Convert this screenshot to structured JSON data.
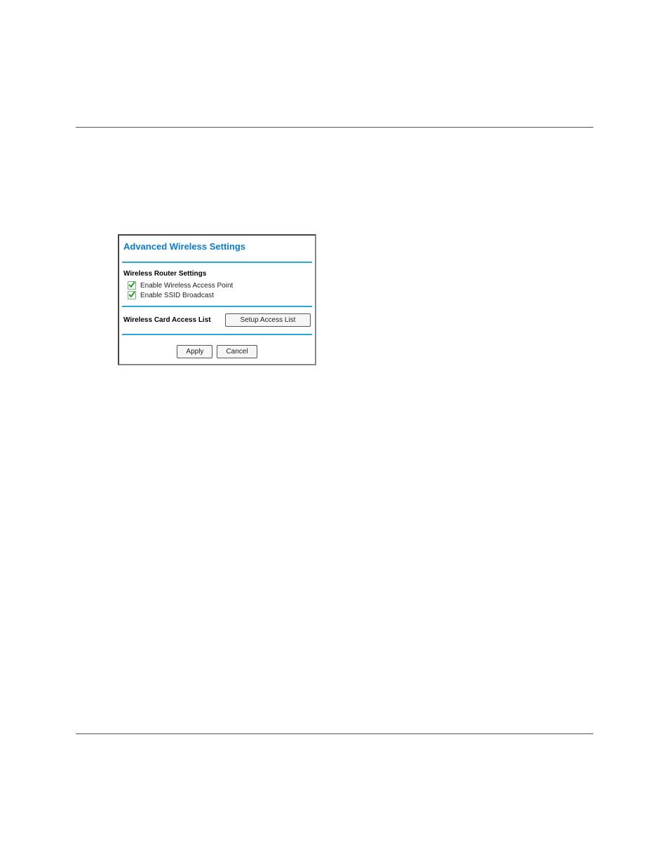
{
  "panel": {
    "title": "Advanced Wireless Settings",
    "section1_header": "Wireless Router Settings",
    "checkboxes": {
      "ap_label": "Enable Wireless Access Point",
      "ssid_label": "Enable SSID Broadcast"
    },
    "access_list_label": "Wireless Card Access List",
    "setup_access_btn": "Setup Access List",
    "apply_btn": "Apply",
    "cancel_btn": "Cancel"
  }
}
